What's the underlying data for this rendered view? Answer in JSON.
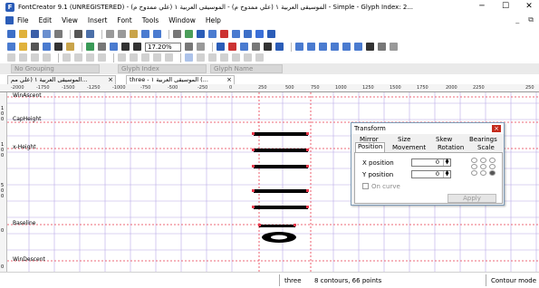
{
  "window": {
    "title": "FontCreator 9.1 (UNREGISTERED) - الموسيقى العربية ١ (علي ممدوح م) - الموسيقى العربية ١ (علي ممدوح م) - Simple - Glyph Index: 2...",
    "app_icon_letter": "F"
  },
  "menu": {
    "items": [
      "File",
      "Edit",
      "View",
      "Insert",
      "Font",
      "Tools",
      "Window",
      "Help"
    ]
  },
  "toolbar": {
    "zoom": "17.20%"
  },
  "grouping": {
    "group_select": "No Grouping",
    "index_select": "Glyph Index",
    "name_select": "Glyph Name"
  },
  "tabs": [
    {
      "label": "الموسيقى العربية ١ (علي مم..."
    },
    {
      "label": "three - الموسيقى العربية ١ (..."
    }
  ],
  "ruler": {
    "ticks": [
      "-2000",
      "-1750",
      "-1500",
      "-1250",
      "-1000",
      "-750",
      "-500",
      "-250",
      "0",
      "250",
      "500",
      "750",
      "1000",
      "1250",
      "1500",
      "1750",
      "2000",
      "2250",
      "250"
    ]
  },
  "guides": {
    "win_ascent": "WinAscent",
    "cap_height": "CapHeight",
    "x_height": "x-Height",
    "baseline": "Baseline",
    "win_descent": "WinDescent"
  },
  "left_ruler_labels": [
    "1",
    "0",
    "0",
    "1",
    "0",
    "0",
    "5",
    "0",
    "0",
    "0",
    "0"
  ],
  "dialog": {
    "title": "Transform",
    "close": "×",
    "tabs_row1": [
      "Mirror",
      "Size",
      "Skew",
      "Bearings"
    ],
    "tabs_row2": [
      "Position",
      "Movement",
      "Rotation",
      "Scale"
    ],
    "x_label": "X position",
    "x_value": "0",
    "y_label": "Y position",
    "y_value": "0",
    "on_curve_label": "On curve",
    "apply_label": "Apply"
  },
  "status": {
    "glyph": "three",
    "info": "8 contours, 66 points",
    "mode": "Contour mode"
  },
  "colors": {
    "guide_red": "#e8384b",
    "grid_purple": "#b7a8e6",
    "glyph_black": "#000000"
  }
}
